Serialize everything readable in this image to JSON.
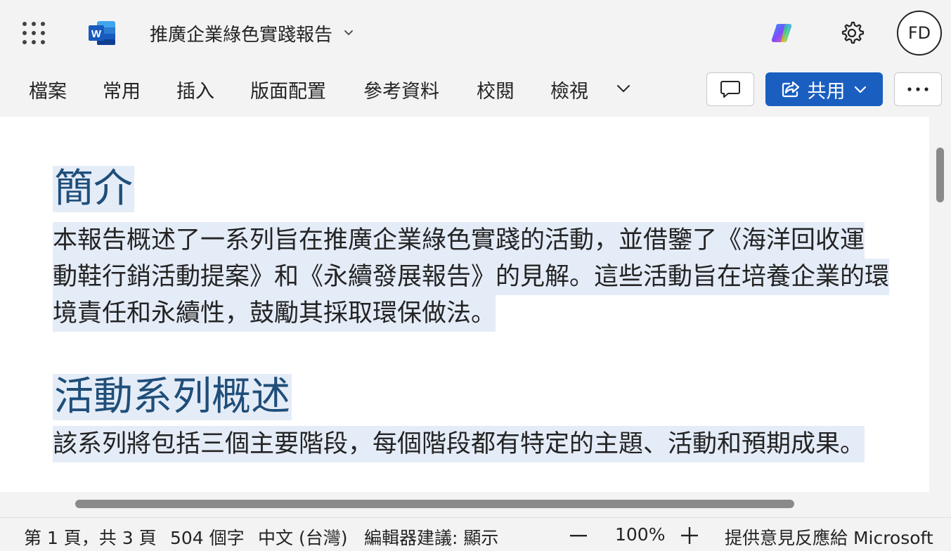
{
  "header": {
    "app_icon": "word-icon",
    "doc_title": "推廣企業綠色實踐報告",
    "avatar_initials": "FD"
  },
  "ribbon": {
    "tabs": [
      "檔案",
      "常用",
      "插入",
      "版面配置",
      "參考資料",
      "校閱",
      "檢視"
    ],
    "share_label": "共用"
  },
  "document": {
    "h1": "簡介",
    "p1_lines": [
      "本報告概述了一系列旨在推廣企業綠色實踐的活動，並借鑒了《海洋回收運",
      "動鞋行銷活動提案》和《永續發展報告》的見解。這些活動旨在培養企業的環",
      "境責任和永續性，鼓勵其採取環保做法。"
    ],
    "h2": "活動系列概述",
    "p2_lines": [
      "該系列將包括三個主要階段，每個階段都有特定的主題、活動和預期成果。"
    ]
  },
  "status": {
    "page": "第 1 頁，共 3 頁",
    "words": "504 個字",
    "language": "中文 (台灣)",
    "editor": "編輯器建議: 顯示",
    "zoom": "100%",
    "feedback": "提供意見反應給 Microsoft"
  },
  "colors": {
    "accent": "#1a5ec0",
    "heading": "#1f4e79",
    "selection": "#e4ecf8"
  }
}
